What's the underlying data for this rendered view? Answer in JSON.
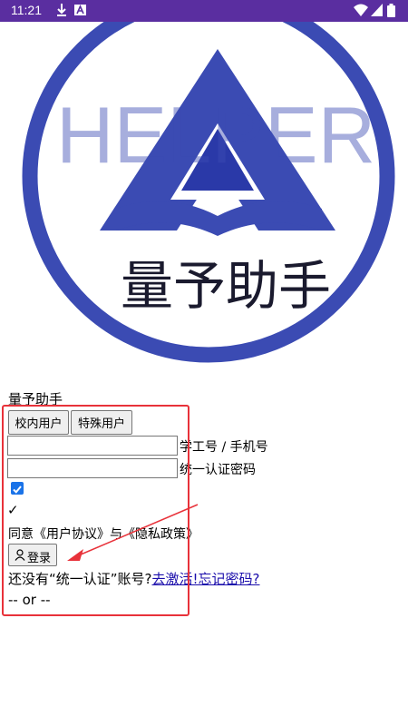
{
  "status_bar": {
    "time": "11:21",
    "bg_color": "#5a2ea0",
    "icons": [
      "download-icon",
      "a-notification-icon",
      "wifi-icon",
      "signal-icon",
      "battery-icon"
    ]
  },
  "logo": {
    "wordmark": "HELPER",
    "title": "量予助手",
    "brand_color": "#3b4bb3"
  },
  "app_name": "量予助手",
  "tabs": [
    {
      "label": "校内用户"
    },
    {
      "label": "特殊用户"
    }
  ],
  "fields": {
    "username": {
      "value": "",
      "label": "学工号 / 手机号"
    },
    "password": {
      "value": "",
      "label": "统一认证密码"
    }
  },
  "agreement": {
    "checked": true,
    "check_mark": "✓",
    "text": "同意《用户协议》与《隐私政策》"
  },
  "login_button": {
    "label": "登录",
    "icon": "user-icon"
  },
  "no_account": {
    "text": "还没有“统一认证”账号?",
    "activate_link": "去激活!",
    "forgot_link": "忘记密码?"
  },
  "divider": "-- or --",
  "annotation_color": "#e8323a"
}
